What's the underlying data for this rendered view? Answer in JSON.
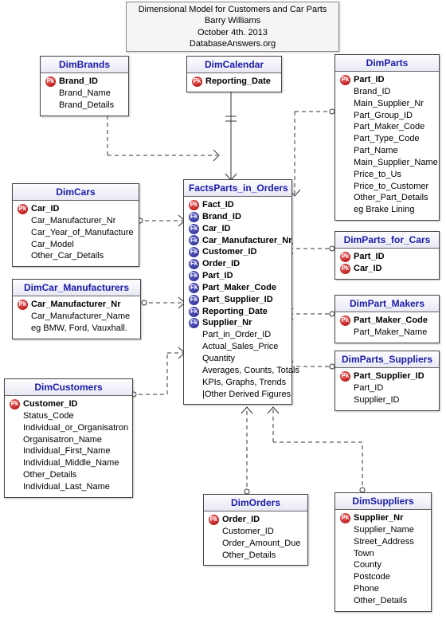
{
  "title": {
    "line1": "Dimensional Model for Customers and Car Parts",
    "line2": "Barry Williams",
    "line3": "October 4th. 2013",
    "line4": "DatabaseAnswers.org"
  },
  "entities": {
    "brands": {
      "name": "DimBrands",
      "attrs": [
        "Brand_ID",
        "Brand_Name",
        "Brand_Details"
      ]
    },
    "calendar": {
      "name": "DimCalendar",
      "attrs": [
        "Reporting_Date"
      ]
    },
    "parts": {
      "name": "DimParts",
      "attrs": [
        "Part_ID",
        "Brand_ID",
        "Main_Supplier_Nr",
        "Part_Group_ID",
        "Part_Maker_Code",
        "Part_Type_Code",
        "Part_Name",
        "Main_Supplier_Name",
        "Price_to_Us",
        "Price_to_Customer",
        "Other_Part_Details",
        "eg Brake Lining"
      ]
    },
    "cars": {
      "name": "DimCars",
      "attrs": [
        "Car_ID",
        "Car_Manufacturer_Nr",
        "Car_Year_of_Manufacture",
        "Car_Model",
        "Other_Car_Details"
      ]
    },
    "fact": {
      "name": "FactsParts_in_Orders",
      "attrs": [
        "Fact_ID",
        "Brand_ID",
        "Car_ID",
        "Car_Manufacturer_Nr",
        "Customer_ID",
        "Order_ID",
        "Part_ID",
        "Part_Maker_Code",
        "Part_Supplier_ID",
        "Reporting_Date",
        "Supplier_Nr",
        "Part_in_Order_ID",
        "Actual_Sales_Price",
        "Quantity",
        "Averages, Counts, Totals",
        "KPIs, Graphs, Trends",
        "|Other Derived Figures"
      ]
    },
    "parts_for_cars": {
      "name": "DimParts_for_Cars",
      "attrs": [
        "Part_ID",
        "Car_ID"
      ]
    },
    "carmfr": {
      "name": "DimCar_Manufacturers",
      "attrs": [
        "Car_Manufacturer_Nr",
        "Car_Manufacturer_Name",
        "eg BMW, Ford, Vauxhall."
      ]
    },
    "part_makers": {
      "name": "DimPart_Makers",
      "attrs": [
        "Part_Maker_Code",
        "Part_Maker_Name"
      ]
    },
    "parts_suppliers": {
      "name": "DimParts_Suppliers",
      "attrs": [
        "Part_Supplier_ID",
        "Part_ID",
        "Supplier_ID"
      ]
    },
    "customers": {
      "name": "DimCustomers",
      "attrs": [
        "Customer_ID",
        "Status_Code",
        "Individual_or_Organisatron",
        "Organisatron_Name",
        "Individual_First_Name",
        "Individual_Middle_Name",
        "Other_Details",
        "Individual_Last_Name"
      ]
    },
    "orders": {
      "name": "DimOrders",
      "attrs": [
        "Order_ID",
        "Customer_ID",
        "Order_Amount_Due",
        "Other_Details"
      ]
    },
    "suppliers": {
      "name": "DimSuppliers",
      "attrs": [
        "Supplier_Nr",
        "Supplier_Name",
        "Street_Address",
        "Town",
        "County",
        "Postcode",
        "Phone",
        "Other_Details"
      ]
    }
  }
}
